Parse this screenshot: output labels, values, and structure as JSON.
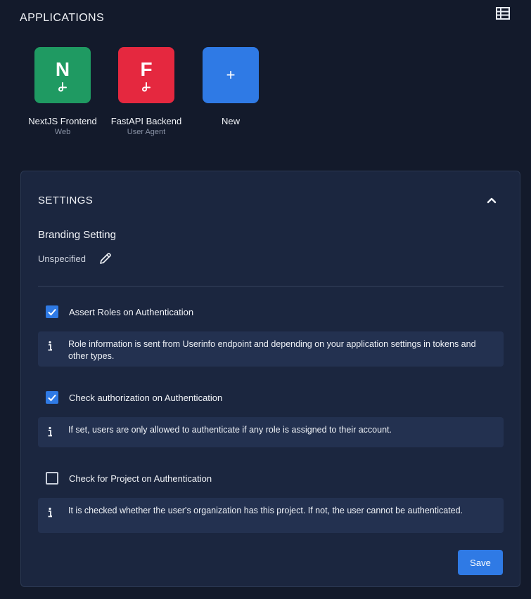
{
  "applications": {
    "title": "APPLICATIONS",
    "view_icon": "table-list-icon",
    "items": [
      {
        "letter": "N",
        "name": "NextJS Frontend",
        "type": "Web",
        "color": "#1f9a62"
      },
      {
        "letter": "F",
        "name": "FastAPI Backend",
        "type": "User Agent",
        "color": "#e5283f"
      },
      {
        "plus": "+",
        "name": "New",
        "color": "#2f7ae5"
      }
    ]
  },
  "settings": {
    "title": "SETTINGS",
    "collapse_icon": "chevron-up-icon",
    "branding": {
      "label": "Branding Setting",
      "value": "Unspecified",
      "edit_icon": "pencil-icon"
    },
    "options": [
      {
        "label": "Assert Roles on Authentication",
        "checked": true,
        "info": "Role information is sent from Userinfo endpoint and depending on your application settings in tokens and other types."
      },
      {
        "label": "Check authorization on Authentication",
        "checked": true,
        "info": "If set, users are only allowed to authenticate if any role is assigned to their account."
      },
      {
        "label": "Check for Project on Authentication",
        "checked": false,
        "info": "It is checked whether the user's organization has this project. If not, the user cannot be authenticated."
      }
    ],
    "save_label": "Save"
  },
  "colors": {
    "background": "#131a2b",
    "card": "#1b263f",
    "info_box": "#233150",
    "accent": "#2f7ae5"
  }
}
